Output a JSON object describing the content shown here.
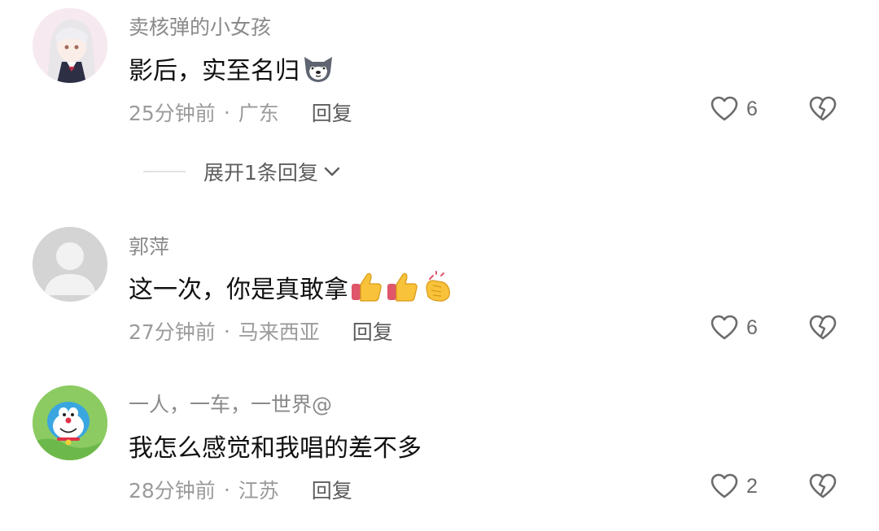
{
  "comments": [
    {
      "username": "卖核弹的小女孩",
      "text": "影后，实至名归",
      "emoji": [
        "husky-dog-face"
      ],
      "time": "25分钟前",
      "separator": "·",
      "location": "广东",
      "reply_label": "回复",
      "likes": "6",
      "expand_label": "展开1条回复"
    },
    {
      "username": "郭萍",
      "text": "这一次，你是真敢拿",
      "emoji": [
        "thumbs-up",
        "thumbs-up",
        "clapping-hands"
      ],
      "time": "27分钟前",
      "separator": "·",
      "location": "马来西亚",
      "reply_label": "回复",
      "likes": "6"
    },
    {
      "username": "一人，一车，一世界@",
      "text": "我怎么感觉和我唱的差不多",
      "emoji": [],
      "time": "28分钟前",
      "separator": "·",
      "location": "江苏",
      "reply_label": "回复",
      "likes": "2"
    }
  ],
  "colors": {
    "username": "#8a8a8a",
    "text": "#111111",
    "meta": "#9b9b9b",
    "icon": "#6b6b6b"
  }
}
